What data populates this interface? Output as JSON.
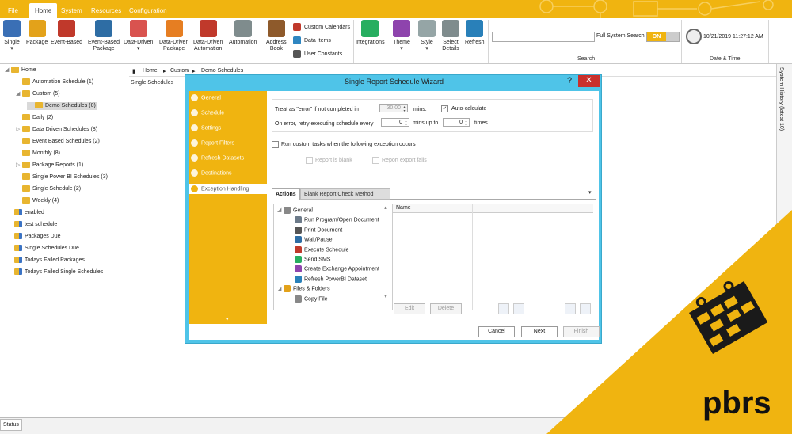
{
  "ribbon": {
    "tabs": [
      "File",
      "Home",
      "System",
      "Resources",
      "Configuration"
    ],
    "buttons": [
      {
        "label": "Single",
        "sub": "▾",
        "icon": "single-schedule-icon",
        "color": "#3a6fb5"
      },
      {
        "label": "Package",
        "sub": "",
        "icon": "package-icon",
        "color": "#e3a21a"
      },
      {
        "label": "Event-Based",
        "sub": "",
        "icon": "event-based-icon",
        "color": "#c0392b"
      },
      {
        "label": "Event-Based",
        "sub": "Package",
        "icon": "event-package-icon",
        "color": "#2e6da4"
      },
      {
        "label": "Data-Driven",
        "sub": "▾",
        "icon": "data-driven-icon",
        "color": "#d9534f"
      },
      {
        "label": "Data-Driven",
        "sub": "Package",
        "icon": "data-driven-package-icon",
        "color": "#e67e22"
      },
      {
        "label": "Data-Driven",
        "sub": "Automation",
        "icon": "data-driven-automation-icon",
        "color": "#c0392b"
      },
      {
        "label": "Automation",
        "sub": "",
        "icon": "automation-icon",
        "color": "#7f8c8d"
      },
      {
        "label": "Address",
        "sub": "Book",
        "icon": "address-book-icon",
        "color": "#8e5a2b"
      },
      {
        "label": "Integrations",
        "sub": "",
        "icon": "integrations-icon",
        "color": "#27ae60"
      },
      {
        "label": "Theme",
        "sub": "▾",
        "icon": "theme-icon",
        "color": "#8e44ad"
      },
      {
        "label": "Style",
        "sub": "▾",
        "icon": "style-icon",
        "color": "#95a5a6"
      },
      {
        "label": "Select",
        "sub": "Details",
        "icon": "select-details-icon",
        "color": "#7f8c8d"
      },
      {
        "label": "Refresh",
        "sub": "",
        "icon": "refresh-icon",
        "color": "#2980b9"
      }
    ],
    "small_buttons": [
      {
        "label": "Custom Calendars",
        "icon": "calendar-icon",
        "color": "#c0392b"
      },
      {
        "label": "Data Items",
        "icon": "data-items-icon",
        "color": "#2e86c1"
      },
      {
        "label": "User Constants",
        "icon": "user-constants-icon",
        "color": "#555555"
      }
    ],
    "search_label": "Full System Search",
    "toggle_on": "ON",
    "group_search": "Search",
    "group_datetime": "Date & Time",
    "datetime": "10/21/2019 11:27:12 AM"
  },
  "tree": [
    {
      "label": "Home",
      "level": 0,
      "exp": "◢",
      "type": "home"
    },
    {
      "label": "Automation Schedule (1)",
      "level": 1,
      "exp": "",
      "type": "folder"
    },
    {
      "label": "Custom (5)",
      "level": 1,
      "exp": "◢",
      "type": "folder"
    },
    {
      "label": "Demo Schedules (0)",
      "level": 2,
      "exp": "",
      "type": "folder",
      "selected": true
    },
    {
      "label": "Daily (2)",
      "level": 1,
      "exp": "",
      "type": "folder"
    },
    {
      "label": "Data Driven Schedules (8)",
      "level": 1,
      "exp": "▷",
      "type": "folder"
    },
    {
      "label": "Event Based Schedules (2)",
      "level": 1,
      "exp": "",
      "type": "folder"
    },
    {
      "label": "Monthly (8)",
      "level": 1,
      "exp": "",
      "type": "folder"
    },
    {
      "label": "Package Reports (1)",
      "level": 1,
      "exp": "▷",
      "type": "folder"
    },
    {
      "label": "Single Power BI Schedules (3)",
      "level": 1,
      "exp": "",
      "type": "folder"
    },
    {
      "label": "Single Schedule (2)",
      "level": 1,
      "exp": "",
      "type": "folder"
    },
    {
      "label": "Weekly (4)",
      "level": 1,
      "exp": "",
      "type": "folder"
    },
    {
      "label": "enabled",
      "level": 0,
      "exp": "",
      "type": "smart"
    },
    {
      "label": "test schedule",
      "level": 0,
      "exp": "",
      "type": "smart"
    },
    {
      "label": "Packages Due",
      "level": 0,
      "exp": "",
      "type": "smart"
    },
    {
      "label": "Single Schedules Due",
      "level": 0,
      "exp": "",
      "type": "smart"
    },
    {
      "label": "Todays Failed Packages",
      "level": 0,
      "exp": "",
      "type": "smart"
    },
    {
      "label": "Todays Failed Single Schedules",
      "level": 0,
      "exp": "",
      "type": "smart"
    }
  ],
  "breadcrumb": [
    "Home",
    "Custom",
    "Demo Schedules"
  ],
  "content_title": "Single Schedules",
  "side_panel": "System History (latest 10)",
  "status": "Status",
  "dialog": {
    "title": "Single Report Schedule Wizard",
    "help": "?",
    "close": "✕",
    "nav": [
      {
        "label": "General",
        "icon": "general-icon"
      },
      {
        "label": "Schedule",
        "icon": "schedule-icon"
      },
      {
        "label": "Settings",
        "icon": "settings-icon"
      },
      {
        "label": "Report Filters",
        "icon": "report-filters-icon"
      },
      {
        "label": "Refresh Datasets",
        "icon": "refresh-datasets-icon"
      },
      {
        "label": "Destinations",
        "icon": "destinations-icon"
      },
      {
        "label": "Exception Handling",
        "icon": "warning-icon",
        "active": true
      }
    ],
    "nav_more": "▾",
    "treat_error": "Treat as \"error\" if not completed in",
    "error_value": "30.00",
    "mins": "mins.",
    "auto_calc": "Auto-calculate",
    "auto_checked": "✓",
    "retry_label": "On error, retry  executing schedule every",
    "retry_value": "0",
    "mins_up_to": "mins up to",
    "times_value": "0",
    "times": "times.",
    "run_custom": "Run custom tasks when the following exception occurs",
    "report_blank": "Report is blank",
    "report_export_fails": "Report export fails",
    "tab_actions": "Actions",
    "tab_blank": "Blank Report Check Method",
    "tabs_arrow": "▾",
    "actions_tree": [
      {
        "label": "General",
        "level": 0,
        "icon": "gear-icon",
        "color": "#888888",
        "exp": "◢"
      },
      {
        "label": "Run Program/Open Document",
        "level": 1,
        "icon": "run-program-icon",
        "color": "#6c7a89"
      },
      {
        "label": "Print Document",
        "level": 1,
        "icon": "print-icon",
        "color": "#555555"
      },
      {
        "label": "Wait/Pause",
        "level": 1,
        "icon": "pause-icon",
        "color": "#2e6da4"
      },
      {
        "label": "Execute Schedule",
        "level": 1,
        "icon": "execute-icon",
        "color": "#c0392b"
      },
      {
        "label": "Send SMS",
        "level": 1,
        "icon": "sms-icon",
        "color": "#27ae60"
      },
      {
        "label": "Create Exchange Appointment",
        "level": 1,
        "icon": "appointment-icon",
        "color": "#8e44ad"
      },
      {
        "label": "Refresh PowerBI Dataset",
        "level": 1,
        "icon": "powerbi-refresh-icon",
        "color": "#2980b9"
      },
      {
        "label": "Files & Folders",
        "level": 0,
        "icon": "folder-icon",
        "color": "#e3a21a",
        "exp": "◢"
      },
      {
        "label": "Copy File",
        "level": 1,
        "icon": "copy-file-icon",
        "color": "#888888"
      }
    ],
    "grid_header": "Name",
    "edit": "Edit",
    "delete": "Delete",
    "cancel": "Cancel",
    "next": "Next",
    "finish": "Finish"
  },
  "brand": {
    "text": "pbrs",
    "color": "#f0b410"
  }
}
